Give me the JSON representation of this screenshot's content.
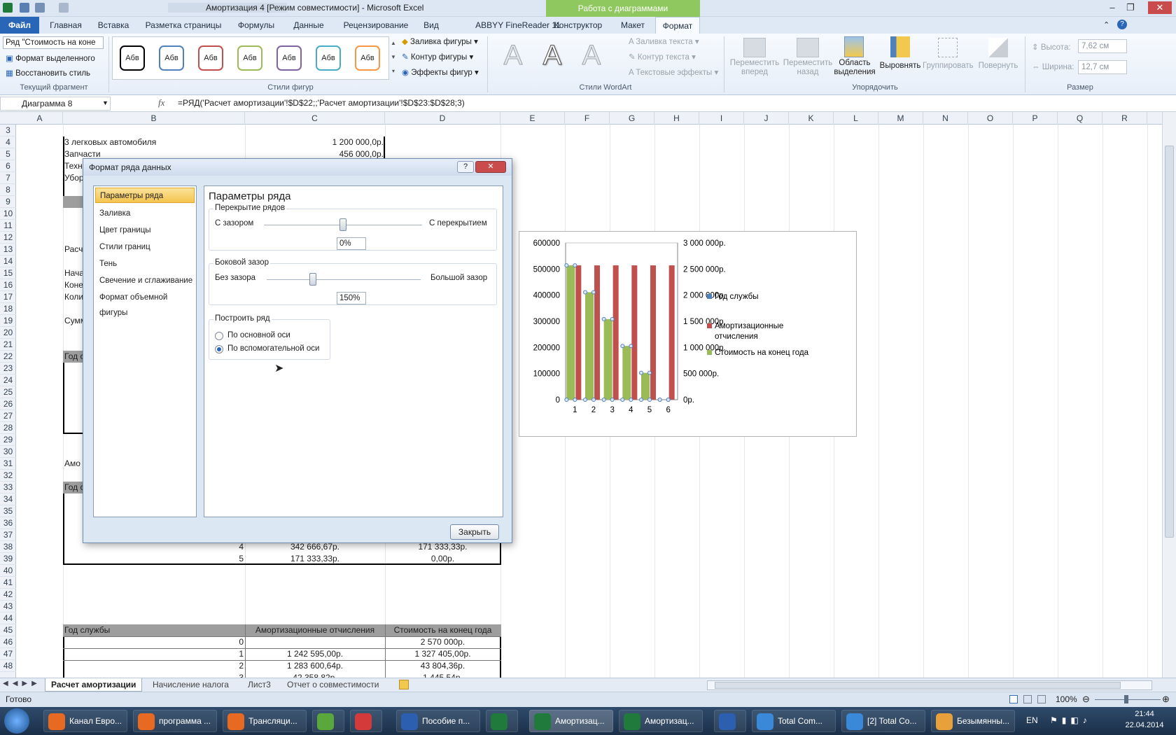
{
  "window": {
    "title": "Амортизация 4  [Режим совместимости]  -  Microsoft Excel",
    "context_tab": "Работа с диаграммами"
  },
  "tabs": [
    "Файл",
    "Главная",
    "Вставка",
    "Разметка страницы",
    "Формулы",
    "Данные",
    "Рецензирование",
    "Вид",
    "ABBYY FineReader 11",
    "Конструктор",
    "Макет",
    "Формат"
  ],
  "ribbon": {
    "selector_value": "Ряд \"Стоимость на коне",
    "format_selection": "Формат выделенного",
    "reset_style": "Восстановить стиль",
    "current_fragment": "Текущий фрагмент",
    "shape_sample": "Абв",
    "shape_styles": "Стили фигур",
    "fill": "Заливка фигуры",
    "outline": "Контур фигуры",
    "effects": "Эффекты фигур",
    "wa_fill": "Заливка текста",
    "wa_outline": "Контур текста",
    "wa_effects": "Текстовые эффекты",
    "wa_group": "Стили WordArt",
    "wa_letter": "A",
    "bring_forward": "Переместить вперед",
    "send_back": "Переместить назад",
    "selection_pane": "Область выделения",
    "align": "Выровнять",
    "group": "Группировать",
    "rotate": "Повернуть",
    "arrange": "Упорядочить",
    "height_label": "Высота:",
    "height_value": "7,62 см",
    "width_label": "Ширина:",
    "width_value": "12,7 см",
    "size_group": "Размер"
  },
  "formula": {
    "namebox": "Диаграмма 8",
    "fx": "fx",
    "text": "=РЯД('Расчет амортизации'!$D$22;;'Расчет амортизации'!$D$23:$D$28;3)"
  },
  "columns": [
    "A",
    "B",
    "C",
    "D",
    "E",
    "F",
    "G",
    "H",
    "I",
    "J",
    "K",
    "L",
    "M",
    "N",
    "O",
    "P",
    "Q",
    "R"
  ],
  "rows": [
    "3",
    "4",
    "5",
    "6",
    "7",
    "8",
    "9",
    "10",
    "11",
    "12",
    "13",
    "14",
    "15",
    "16",
    "17",
    "18",
    "19",
    "20",
    "21",
    "22",
    "23",
    "24",
    "25",
    "26",
    "27",
    "28",
    "29",
    "30",
    "31",
    "32",
    "33",
    "34",
    "35",
    "36",
    "37",
    "38",
    "39",
    "40",
    "41",
    "42",
    "43",
    "44",
    "45",
    "46",
    "47",
    "48"
  ],
  "cells": {
    "r4b": "3 легковых автомобиля",
    "r4c": "1 200 000,0р.",
    "r5b": "Запчасти",
    "r5c": "456 000,0р.",
    "r6b": "Техн",
    "r7b": "Убор",
    "r13b": "Расч",
    "r15b": "Нача",
    "r16b": "Коне",
    "r17b": "Коли",
    "r19b": "Сумм",
    "r22b": "Год с",
    "r31b": "Амо",
    "r33b": "Год с",
    "r38c": "4",
    "r38d": "342 666,67р.",
    "r38e": "171 333,33р.",
    "r39c": "5",
    "r39d": "171 333,33р.",
    "r39e": "0,00р.",
    "r44b": "Год службы",
    "r44d": "Амортизационные отчисления",
    "r44e": "Стоимость на конец года",
    "r45c": "0",
    "r45e": "2 570 000р.",
    "r46c": "1",
    "r46d": "1 242 595,00р.",
    "r46e": "1 327 405,00р.",
    "r47c": "2",
    "r47d": "1 283 600,64р.",
    "r47e": "43 804,36р.",
    "r48c": "3",
    "r48d": "42 358,82р.",
    "r48e": "1 445,54р."
  },
  "dialog": {
    "title": "Формат ряда данных",
    "help": "?",
    "close_x": "✕",
    "nav": [
      "Параметры ряда",
      "Заливка",
      "Цвет границы",
      "Стили границ",
      "Тень",
      "Свечение и сглаживание",
      "Формат объемной фигуры"
    ],
    "heading": "Параметры ряда",
    "overlap": {
      "legend": "Перекрытие рядов",
      "left": "С зазором",
      "right": "С перекрытием",
      "value": "0%",
      "level": 0.5
    },
    "gap": {
      "legend": "Боковой зазор",
      "left": "Без зазора",
      "right": "Большой зазор",
      "value": "150%",
      "level": 0.3
    },
    "plot": {
      "legend": "Построить ряд",
      "primary": "По основной оси",
      "secondary": "По вспомогательной оси"
    },
    "close_button": "Закрыть"
  },
  "chart_data": {
    "type": "bar",
    "categories": [
      "1",
      "2",
      "3",
      "4",
      "5",
      "6"
    ],
    "series": [
      {
        "name": "Год службы",
        "values": [],
        "color": "#4f81bd"
      },
      {
        "name": "Амортизационные отчисления",
        "values": [
          514000,
          514000,
          514000,
          514000,
          514000,
          514000
        ],
        "axis": "primary",
        "color": "#c0504d"
      },
      {
        "name": "Стоимость на конец года",
        "values": [
          2570000,
          2056000,
          1542000,
          1028000,
          514000,
          0
        ],
        "axis": "secondary",
        "color": "#9bbb59"
      }
    ],
    "y_primary_ticks": [
      "600000",
      "500000",
      "400000",
      "300000",
      "200000",
      "100000",
      "0"
    ],
    "y_secondary_ticks": [
      "3 000 000р.",
      "2 500 000р.",
      "2 000 000р.",
      "1 500 000р.",
      "1 000 000р.",
      "500 000р.",
      "0р."
    ],
    "ylim": [
      0,
      600000
    ],
    "y2lim": [
      0,
      3000000
    ],
    "legend_position": "right"
  },
  "sheets": [
    "Расчет амортизации",
    "Начисление налога",
    "Лист3",
    "Отчет о совместимости"
  ],
  "status": {
    "ready": "Готово",
    "zoom": "100%"
  },
  "taskbar": {
    "items": [
      "Канал Евро...",
      "программа ...",
      "Трансляци...",
      "",
      "",
      "Пособие п...",
      "",
      "Амортизац...",
      "Амортизац...",
      "",
      "Total Com...",
      "[2] Total Co...",
      "Безымянны..."
    ],
    "lang": "EN",
    "time": "21:44",
    "date": "22.04.2014"
  }
}
